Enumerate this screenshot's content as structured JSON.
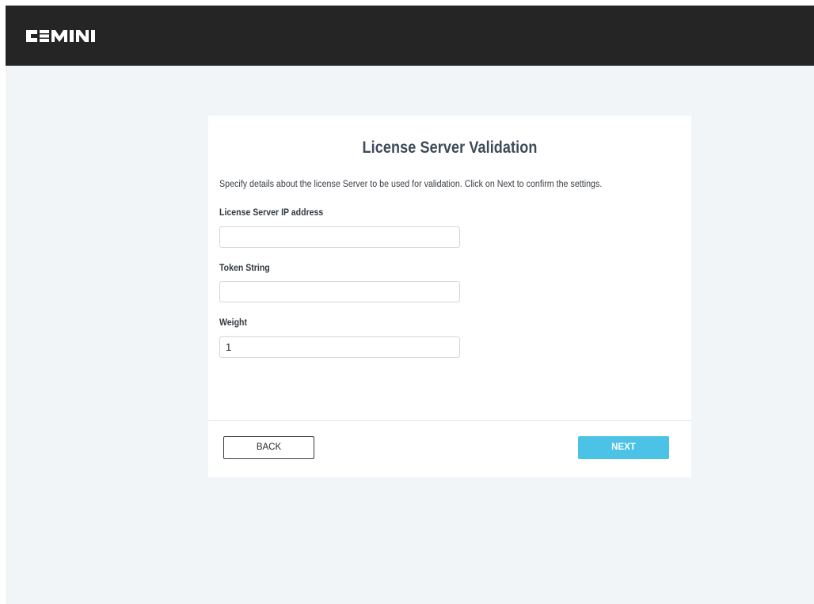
{
  "header": {
    "logo_text": "CEMINI",
    "logo_icon": "cemini-logo"
  },
  "form": {
    "title": "License Server Validation",
    "description": "Specify details about the license Server to be used for validation. Click on Next to confirm the settings.",
    "fields": [
      {
        "label": "License Server IP address",
        "value": "",
        "placeholder": ""
      },
      {
        "label": "Token String",
        "value": "",
        "placeholder": ""
      },
      {
        "label": "Weight",
        "value": "1",
        "placeholder": ""
      }
    ],
    "back_label": "BACK",
    "next_label": "NEXT"
  },
  "colors": {
    "header_bg": "#252525",
    "page_bg": "#f1f5f8",
    "accent": "#4bc2e6",
    "title": "#3d4a5a"
  }
}
